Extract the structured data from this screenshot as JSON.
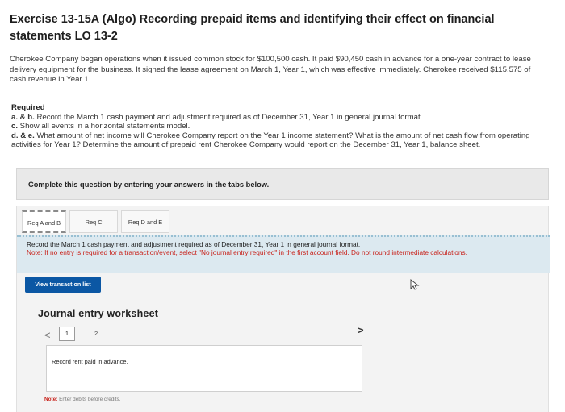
{
  "title": "Exercise 13-15A (Algo) Recording prepaid items and identifying their effect on financial statements LO 13-2",
  "intro": "Cherokee Company began operations when it issued common stock for $100,500 cash. It paid $90,450 cash in advance for a one-year contract to lease delivery equipment for the business. It signed the lease agreement on March 1, Year 1, which was effective immediately. Cherokee received $115,575 of cash revenue in Year 1.",
  "required": {
    "heading": "Required",
    "items": [
      {
        "label": "a. & b.",
        "text": " Record the March 1 cash payment and adjustment required as of December 31, Year 1 in general journal format."
      },
      {
        "label": "c.",
        "text": " Show all events in a horizontal statements model."
      },
      {
        "label": "d. & e.",
        "text": " What amount of net income will Cherokee Company report on the Year 1 income statement? What is the amount of net cash flow from operating activities for Year 1? Determine the amount of prepaid rent Cherokee Company would report on the December 31, Year 1, balance sheet."
      }
    ]
  },
  "complete_prompt": "Complete this question by entering your answers in the tabs below.",
  "tabs": [
    {
      "label": "Req A and B",
      "active": true
    },
    {
      "label": "Req C",
      "active": false
    },
    {
      "label": "Req D and E",
      "active": false
    }
  ],
  "instruction": {
    "main": "Record the March 1 cash payment and adjustment required as of December 31, Year 1 in general journal format.",
    "note": "Note: If no entry is required for a transaction/event, select \"No journal entry required\" in the first account field. Do not round intermediate calculations."
  },
  "view_button": "View transaction list",
  "worksheet": {
    "title": "Journal entry worksheet",
    "prev": "<",
    "next": ">",
    "pages": [
      "1",
      "2"
    ],
    "current_page": "1",
    "entry_text": "Record rent paid in advance.",
    "note_label": "Note:",
    "note_text": " Enter debits before credits."
  },
  "colors": {
    "button_bg": "#0b57a4",
    "instruction_bg": "#dce9f0",
    "note_red": "#c8221b"
  },
  "icons": [
    "cursor-icon"
  ]
}
